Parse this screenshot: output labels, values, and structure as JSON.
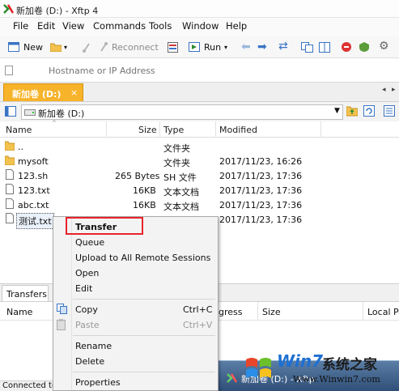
{
  "window": {
    "title": "新加卷 (D:) - Xftp 4"
  },
  "menubar": [
    "File",
    "Edit",
    "View",
    "Commands",
    "Tools",
    "Window",
    "Help"
  ],
  "toolbar": {
    "new_label": "New",
    "reconnect_label": "Reconnect",
    "run_label": "Run"
  },
  "address": {
    "placeholder": "Hostname or IP Address"
  },
  "tab": {
    "label": "新加卷 (D:)"
  },
  "path": {
    "value": "新加卷 (D:)"
  },
  "filelist": {
    "columns": [
      "Name",
      "Size",
      "Type",
      "Modified"
    ],
    "rows": [
      {
        "name": "..",
        "size": "",
        "type": "文件夹",
        "modified": "",
        "icon": "folder-icon"
      },
      {
        "name": "mysoft",
        "size": "",
        "type": "文件夹",
        "modified": "2017/11/23, 16:26",
        "icon": "folder-icon"
      },
      {
        "name": "123.sh",
        "size": "265 Bytes",
        "type": "SH 文件",
        "modified": "2017/11/23, 17:36",
        "icon": "file-icon"
      },
      {
        "name": "123.txt",
        "size": "16KB",
        "type": "文本文档",
        "modified": "2017/11/23, 17:36",
        "icon": "file-icon"
      },
      {
        "name": "abc.txt",
        "size": "16KB",
        "type": "文本文档",
        "modified": "2017/11/23, 17:36",
        "icon": "file-icon"
      },
      {
        "name": "测试.txt",
        "size": "",
        "type": "文本文档",
        "modified": "2017/11/23, 17:36",
        "icon": "file-icon"
      }
    ]
  },
  "bottom": {
    "tab_label": "Transfers",
    "columns": [
      "Name",
      "gress",
      "Size",
      "Local Pa"
    ],
    "status": "Connected to"
  },
  "context_menu": {
    "transfer": "Transfer",
    "queue": "Queue",
    "upload_all": "Upload to All Remote Sessions",
    "open": "Open",
    "edit": "Edit",
    "copy": "Copy",
    "copy_shortcut": "Ctrl+C",
    "paste": "Paste",
    "paste_shortcut": "Ctrl+V",
    "rename": "Rename",
    "delete": "Delete",
    "properties": "Properties"
  },
  "taskbar": {
    "label": "新加卷 (D:) - Xftp"
  },
  "watermark": {
    "brand": "Win7",
    "text": "系统之家",
    "url": "Www.Winwin7.com"
  },
  "colors": {
    "accent_tab": "#f7b32a",
    "highlight_box": "#e8232a"
  }
}
